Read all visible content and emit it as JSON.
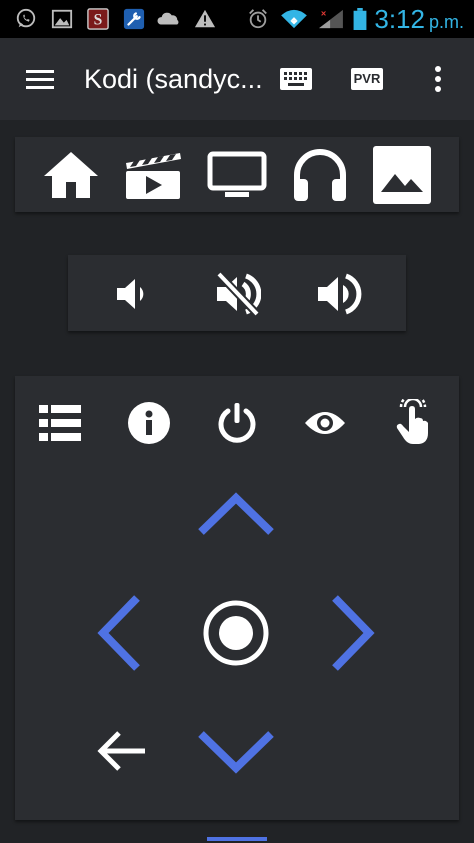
{
  "status_bar": {
    "time": "3:12",
    "ampm": "p.m.",
    "icons": [
      "whatsapp-icon",
      "gallery-icon",
      "s-app-icon",
      "tools-icon",
      "cloud-icon",
      "warning-icon",
      "alarm-icon",
      "wifi-icon",
      "signal-icon",
      "battery-icon"
    ]
  },
  "toolbar": {
    "title": "Kodi (sandyc...",
    "pvr_label": "PVR"
  },
  "media_bar": [
    "home-icon",
    "movies-icon",
    "tv-icon",
    "music-icon",
    "pictures-icon"
  ],
  "volume_bar": [
    "volume-down-icon",
    "mute-icon",
    "volume-up-icon"
  ],
  "remote_actions": [
    "list-icon",
    "info-icon",
    "power-icon",
    "view-icon",
    "gesture-icon"
  ],
  "colors": {
    "accent": "#4f72e3",
    "status_time": "#33b5e5",
    "background": "#212326",
    "panel": "#2b2d31"
  }
}
